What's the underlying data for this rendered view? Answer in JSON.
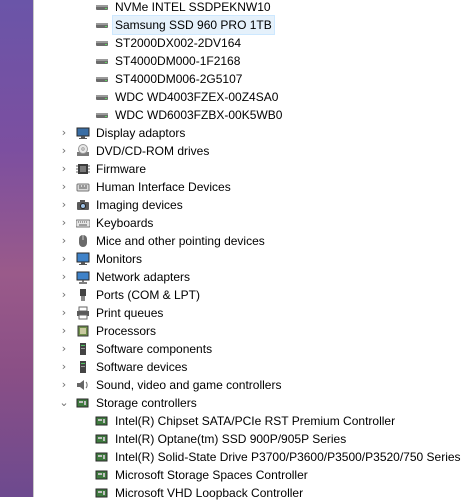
{
  "disk_drives": [
    {
      "label": "NVMe INTEL SSDPEKNW10",
      "icon": "disk-drive-icon"
    },
    {
      "label": "Samsung SSD 960 PRO 1TB",
      "icon": "disk-drive-icon",
      "selected": true
    },
    {
      "label": "ST2000DX002-2DV164",
      "icon": "disk-drive-icon"
    },
    {
      "label": "ST4000DM000-1F2168",
      "icon": "disk-drive-icon"
    },
    {
      "label": "ST4000DM006-2G5107",
      "icon": "disk-drive-icon"
    },
    {
      "label": "WDC WD4003FZEX-00Z4SA0",
      "icon": "disk-drive-icon"
    },
    {
      "label": "WDC WD6003FZBX-00K5WB0",
      "icon": "disk-drive-icon"
    }
  ],
  "categories": [
    {
      "label": "Display adaptors",
      "icon": "display-adapter-icon",
      "expanded": false
    },
    {
      "label": "DVD/CD-ROM drives",
      "icon": "dvd-drive-icon",
      "expanded": false
    },
    {
      "label": "Firmware",
      "icon": "firmware-icon",
      "expanded": false
    },
    {
      "label": "Human Interface Devices",
      "icon": "hid-icon",
      "expanded": false
    },
    {
      "label": "Imaging devices",
      "icon": "camera-icon",
      "expanded": false
    },
    {
      "label": "Keyboards",
      "icon": "keyboard-icon",
      "expanded": false
    },
    {
      "label": "Mice and other pointing devices",
      "icon": "mouse-icon",
      "expanded": false
    },
    {
      "label": "Monitors",
      "icon": "monitor-icon",
      "expanded": false
    },
    {
      "label": "Network adapters",
      "icon": "network-adapter-icon",
      "expanded": false
    },
    {
      "label": "Ports (COM & LPT)",
      "icon": "port-icon",
      "expanded": false
    },
    {
      "label": "Print queues",
      "icon": "printer-icon",
      "expanded": false
    },
    {
      "label": "Processors",
      "icon": "processor-icon",
      "expanded": false
    },
    {
      "label": "Software components",
      "icon": "software-component-icon",
      "expanded": false
    },
    {
      "label": "Software devices",
      "icon": "software-device-icon",
      "expanded": false
    },
    {
      "label": "Sound, video and game controllers",
      "icon": "speaker-icon",
      "expanded": false
    },
    {
      "label": "Storage controllers",
      "icon": "storage-controller-icon",
      "expanded": true
    }
  ],
  "storage_controllers": [
    {
      "label": "Intel(R) Chipset SATA/PCIe RST Premium Controller",
      "icon": "storage-controller-icon"
    },
    {
      "label": "Intel(R) Optane(tm) SSD 900P/905P Series",
      "icon": "storage-controller-icon"
    },
    {
      "label": "Intel(R) Solid-State Drive P3700/P3600/P3500/P3520/750 Series",
      "icon": "storage-controller-icon"
    },
    {
      "label": "Microsoft Storage Spaces Controller",
      "icon": "storage-controller-icon"
    },
    {
      "label": "Microsoft VHD Loopback Controller",
      "icon": "storage-controller-icon"
    }
  ],
  "colors": {
    "selection_bg": "#e5f1fb",
    "selection_border": "#cde8ff",
    "chevron": "#6e6e6e"
  }
}
